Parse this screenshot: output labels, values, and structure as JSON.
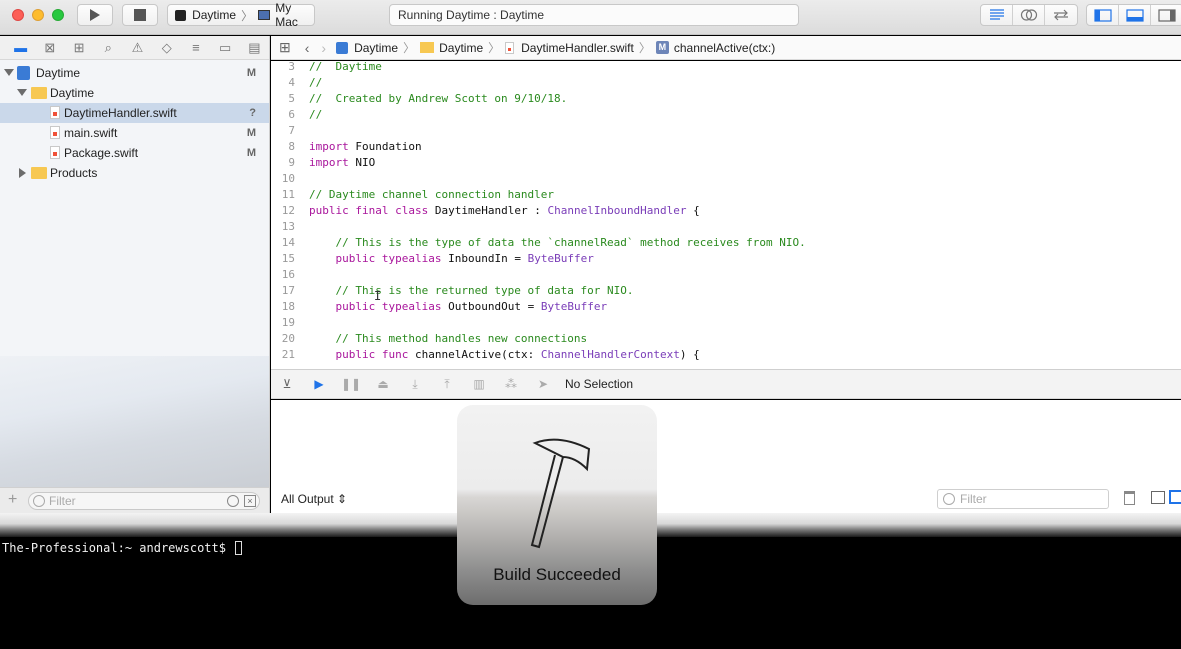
{
  "toolbar": {
    "scheme": "Daytime",
    "destination": "My Mac",
    "activity": "Running Daytime : Daytime"
  },
  "navigator": {
    "items": [
      {
        "label": "Daytime",
        "badge": "M",
        "kind": "project"
      },
      {
        "label": "Daytime",
        "badge": "",
        "kind": "folder"
      },
      {
        "label": "DaytimeHandler.swift",
        "badge": "?",
        "kind": "swift"
      },
      {
        "label": "main.swift",
        "badge": "M",
        "kind": "swift"
      },
      {
        "label": "Package.swift",
        "badge": "M",
        "kind": "swift"
      },
      {
        "label": "Products",
        "badge": "",
        "kind": "folder"
      }
    ],
    "filter_placeholder": "Filter"
  },
  "jumpbar": {
    "crumbs": [
      "Daytime",
      "Daytime",
      "DaytimeHandler.swift",
      "channelActive(ctx:)"
    ]
  },
  "editor": {
    "lines": [
      {
        "n": "3",
        "text": "//  Daytime"
      },
      {
        "n": "4",
        "text": "//"
      },
      {
        "n": "5",
        "text": "//  Created by Andrew Scott on 9/10/18."
      },
      {
        "n": "6",
        "text": "//"
      },
      {
        "n": "7",
        "text": ""
      },
      {
        "n": "8",
        "text": "import Foundation"
      },
      {
        "n": "9",
        "text": "import NIO"
      },
      {
        "n": "10",
        "text": ""
      },
      {
        "n": "11",
        "text": "// Daytime channel connection handler"
      },
      {
        "n": "12",
        "text": "public final class DaytimeHandler : ChannelInboundHandler {"
      },
      {
        "n": "13",
        "text": ""
      },
      {
        "n": "14",
        "text": "    // This is the type of data the `channelRead` method receives from NIO."
      },
      {
        "n": "15",
        "text": "    public typealias InboundIn = ByteBuffer"
      },
      {
        "n": "16",
        "text": ""
      },
      {
        "n": "17",
        "text": "    // This is the returned type of data for NIO."
      },
      {
        "n": "18",
        "text": "    public typealias OutboundOut = ByteBuffer"
      },
      {
        "n": "19",
        "text": ""
      },
      {
        "n": "20",
        "text": "    // This method handles new connections"
      },
      {
        "n": "21",
        "text": "    public func channelActive(ctx: ChannelHandlerContext) {"
      }
    ]
  },
  "debug": {
    "selection": "No Selection"
  },
  "console": {
    "output_selector": "All Output",
    "filter_placeholder": "Filter"
  },
  "terminal": {
    "prompt": "The-Professional:~ andrewscott$"
  },
  "hud": {
    "label": "Build Succeeded"
  }
}
